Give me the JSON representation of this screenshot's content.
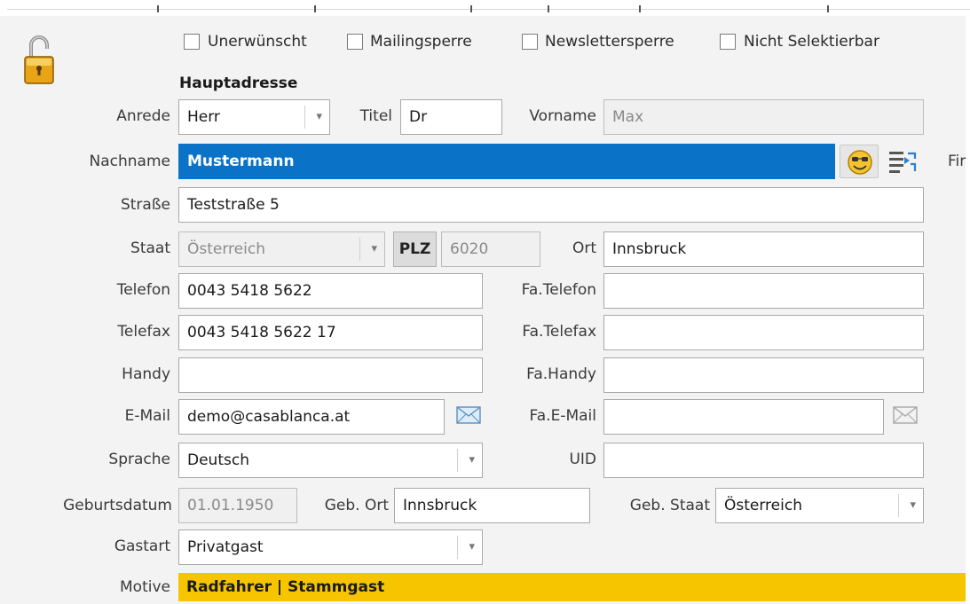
{
  "checkboxes": [
    {
      "label": "Unerwünscht",
      "checked": false
    },
    {
      "label": "Mailingsperre",
      "checked": false
    },
    {
      "label": "Newslettersperre",
      "checked": false
    },
    {
      "label": "Nicht Selektierbar",
      "checked": false
    }
  ],
  "section_title": "Hauptadresse",
  "labels": {
    "anrede": "Anrede",
    "titel": "Titel",
    "vorname": "Vorname",
    "nachname": "Nachname",
    "strasse": "Straße",
    "staat": "Staat",
    "ort": "Ort",
    "telefon": "Telefon",
    "fa_telefon": "Fa.Telefon",
    "telefax": "Telefax",
    "fa_telefax": "Fa.Telefax",
    "handy": "Handy",
    "fa_handy": "Fa.Handy",
    "email": "E-Mail",
    "fa_email": "Fa.E-Mail",
    "sprache": "Sprache",
    "uid": "UID",
    "geburtsdatum": "Geburtsdatum",
    "geb_ort": "Geb. Ort",
    "geb_staat": "Geb. Staat",
    "gastart": "Gastart",
    "motive": "Motive",
    "cut_off": "Fir"
  },
  "values": {
    "anrede": "Herr",
    "titel": "Dr",
    "vorname": "Max",
    "nachname": "Mustermann",
    "strasse": "Teststraße 5",
    "staat": "Österreich",
    "plz_button": "PLZ",
    "plz": "6020",
    "ort": "Innsbruck",
    "telefon": "0043 5418 5622",
    "fa_telefon": "",
    "telefax": "0043 5418 5622 17",
    "fa_telefax": "",
    "handy": "",
    "fa_handy": "",
    "email": "demo@casablanca.at",
    "fa_email": "",
    "sprache": "Deutsch",
    "uid": "",
    "geburtsdatum": "01.01.1950",
    "geb_ort": "Innsbruck",
    "geb_staat": "Österreich",
    "gastart": "Privatgast",
    "motive": "Radfahrer | Stammgast"
  },
  "icons": {
    "lock": "unlocked-padlock-icon",
    "smiley": "smiley-icon",
    "list_edit": "list-edit-icon",
    "mail": "envelope-icon"
  },
  "colors": {
    "selected_field": "#0a73c7",
    "motive_highlight": "#f7c400",
    "lock_gold": "#e8a317"
  }
}
